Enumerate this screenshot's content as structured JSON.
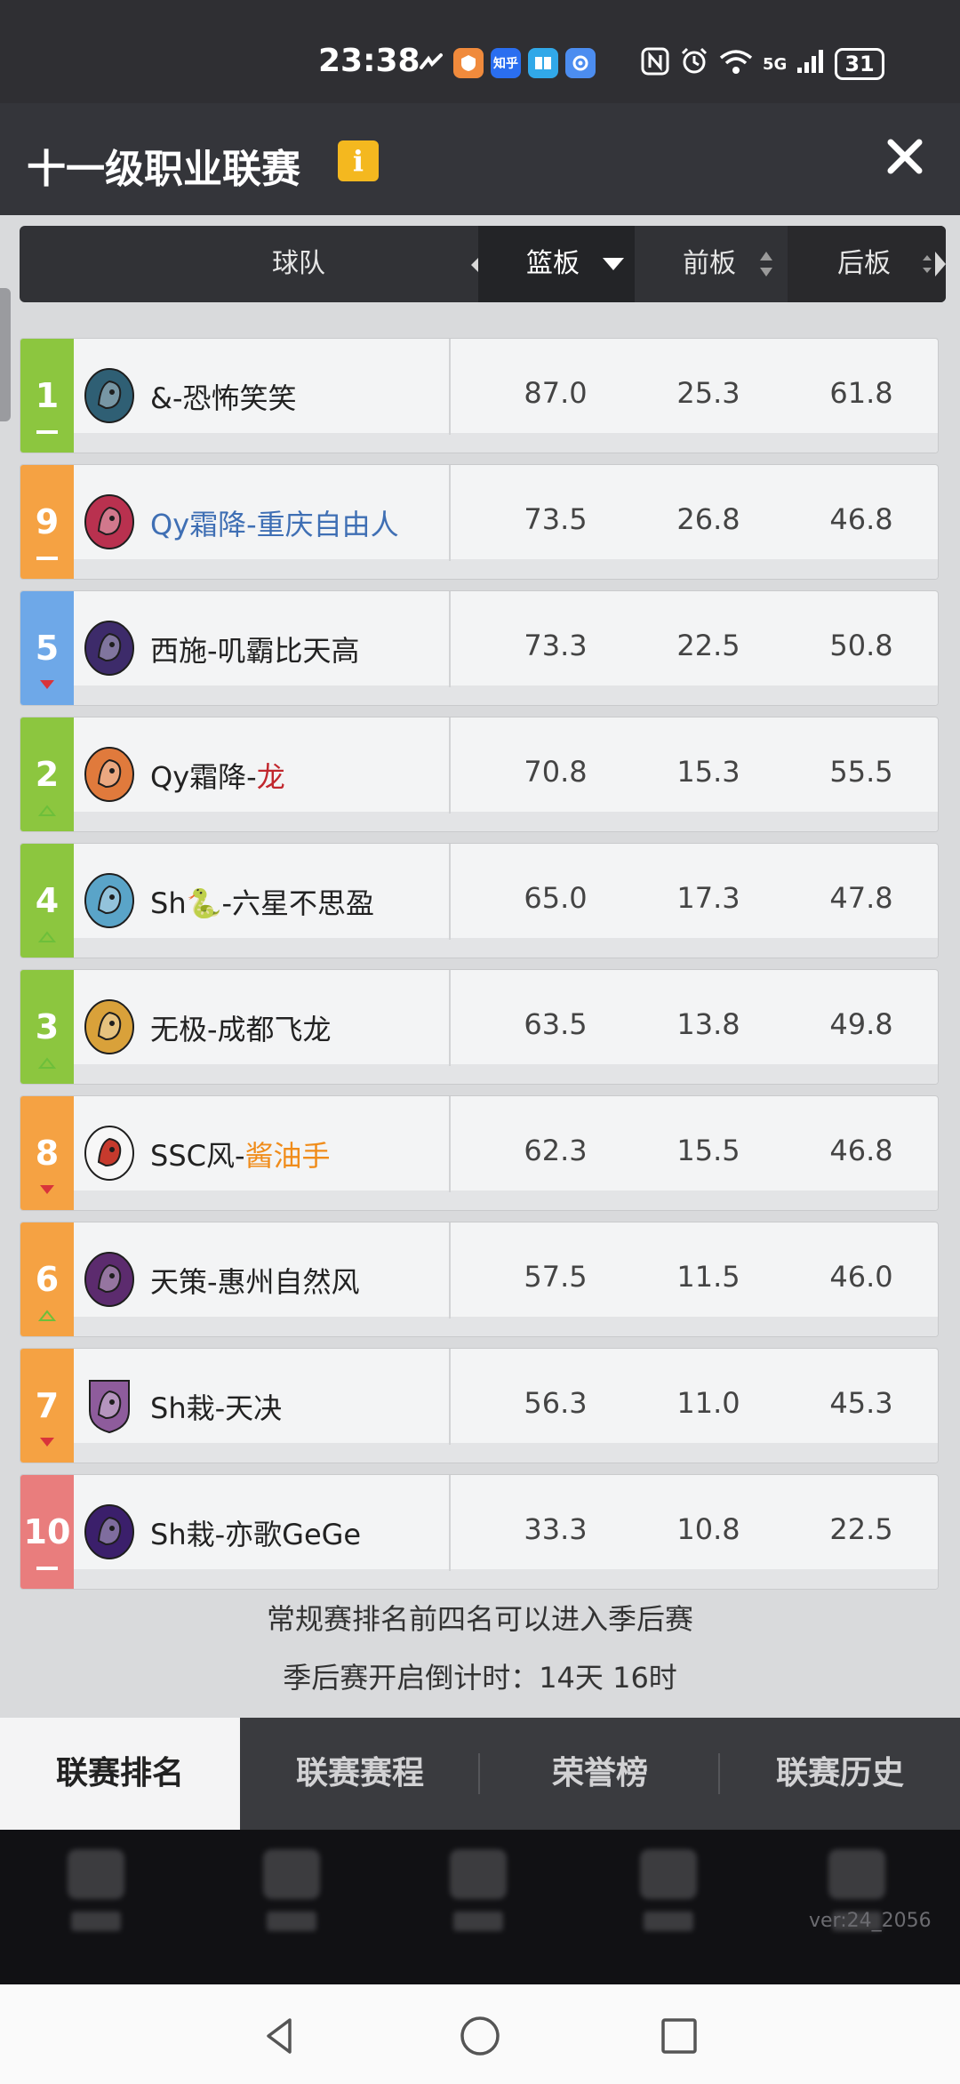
{
  "status_bar": {
    "time": "23:38",
    "app_icons": [
      "route-icon",
      "shield-app-icon",
      "zhihu-icon",
      "book-icon",
      "settings-app-icon"
    ],
    "zhihu_label": "知乎",
    "signal_label": "5G",
    "battery": "31"
  },
  "header": {
    "title": "十一级职业联赛",
    "info_label": "i"
  },
  "columns": {
    "team": "球队",
    "rebounds": "篮板",
    "offensive": "前板",
    "defensive": "后板"
  },
  "rows": [
    {
      "rank": "1",
      "trend": "same",
      "tier": "green",
      "team": "&-恐怖笑笑",
      "team_suffix": "",
      "name_color": "#222222",
      "suffix_color": "",
      "rebounds": "87.0",
      "offensive": "25.3",
      "defensive": "61.8",
      "avatar_color": "#2f5f74",
      "avatar_icon": "zebra-icon"
    },
    {
      "rank": "9",
      "trend": "same",
      "tier": "orange",
      "team": "Qy霜降-重庆自由人",
      "team_suffix": "",
      "name_color": "#3f6fb4",
      "suffix_color": "",
      "rebounds": "73.5",
      "offensive": "26.8",
      "defensive": "46.8",
      "avatar_color": "#b9314f",
      "avatar_icon": "bear-icon"
    },
    {
      "rank": "5",
      "trend": "down",
      "tier": "blue",
      "team": "西施-叽霸比天高",
      "team_suffix": "",
      "name_color": "#222222",
      "suffix_color": "",
      "rebounds": "73.3",
      "offensive": "22.5",
      "defensive": "50.8",
      "avatar_color": "#3d2b6a",
      "avatar_icon": "ball-icon"
    },
    {
      "rank": "2",
      "trend": "up",
      "tier": "green",
      "team": "Qy霜降-",
      "team_suffix": "龙",
      "name_color": "#222222",
      "suffix_color": "#c1272d",
      "rebounds": "70.8",
      "offensive": "15.3",
      "defensive": "55.5",
      "avatar_color": "#e07a3c",
      "avatar_icon": "dragon-icon"
    },
    {
      "rank": "4",
      "trend": "up",
      "tier": "green",
      "team": "Sh🐍-六星不思盈",
      "team_suffix": "",
      "name_color": "#222222",
      "suffix_color": "",
      "rebounds": "65.0",
      "offensive": "17.3",
      "defensive": "47.8",
      "avatar_color": "#5aa4c8",
      "avatar_icon": "dragon-icon"
    },
    {
      "rank": "3",
      "trend": "up",
      "tier": "green",
      "team": "无极-成都飞龙",
      "team_suffix": "",
      "name_color": "#222222",
      "suffix_color": "",
      "rebounds": "63.5",
      "offensive": "13.8",
      "defensive": "49.8",
      "avatar_color": "#d9a13a",
      "avatar_icon": "dragon-icon"
    },
    {
      "rank": "8",
      "trend": "down",
      "tier": "orange",
      "team": "SSC风-",
      "team_suffix": "酱油手",
      "name_color": "#222222",
      "suffix_color": "#f08c1a",
      "rebounds": "62.3",
      "offensive": "15.5",
      "defensive": "46.8",
      "avatar_color": "#f7f7f7",
      "avatar_icon": "spartan-icon"
    },
    {
      "rank": "6",
      "trend": "up",
      "tier": "orange",
      "team": "天策-惠州自然风",
      "team_suffix": "",
      "name_color": "#222222",
      "suffix_color": "",
      "rebounds": "57.5",
      "offensive": "11.5",
      "defensive": "46.0",
      "avatar_color": "#5c2b6e",
      "avatar_icon": "basketball-icon"
    },
    {
      "rank": "7",
      "trend": "down",
      "tier": "orange",
      "team": "Sh栽-天决",
      "team_suffix": "",
      "name_color": "#222222",
      "suffix_color": "",
      "rebounds": "56.3",
      "offensive": "11.0",
      "defensive": "45.3",
      "avatar_color": "#8e5c9c",
      "avatar_icon": "beast-shield-icon"
    },
    {
      "rank": "10",
      "trend": "same",
      "tier": "red",
      "team": "Sh栽-亦歌GeGe",
      "team_suffix": "",
      "name_color": "#222222",
      "suffix_color": "",
      "rebounds": "33.3",
      "offensive": "10.8",
      "defensive": "22.5",
      "avatar_color": "#3b1f6b",
      "avatar_icon": "wolf-icon"
    }
  ],
  "tier_colors": {
    "green": "#8cc63f",
    "orange": "#f5a243",
    "blue": "#6ea8e8",
    "red": "#e97d7d"
  },
  "trend_colors": {
    "up": "#6dbf3a",
    "down": "#d9343a",
    "same": "#ffffff"
  },
  "notes": {
    "line1": "常规赛排名前四名可以进入季后赛",
    "line2": "季后赛开启倒计时：14天 16时"
  },
  "tabs": [
    {
      "label": "联赛排名",
      "active": true
    },
    {
      "label": "联赛赛程",
      "active": false
    },
    {
      "label": "荣誉榜",
      "active": false
    },
    {
      "label": "联赛历史",
      "active": false
    }
  ],
  "version": "ver:24_2056"
}
